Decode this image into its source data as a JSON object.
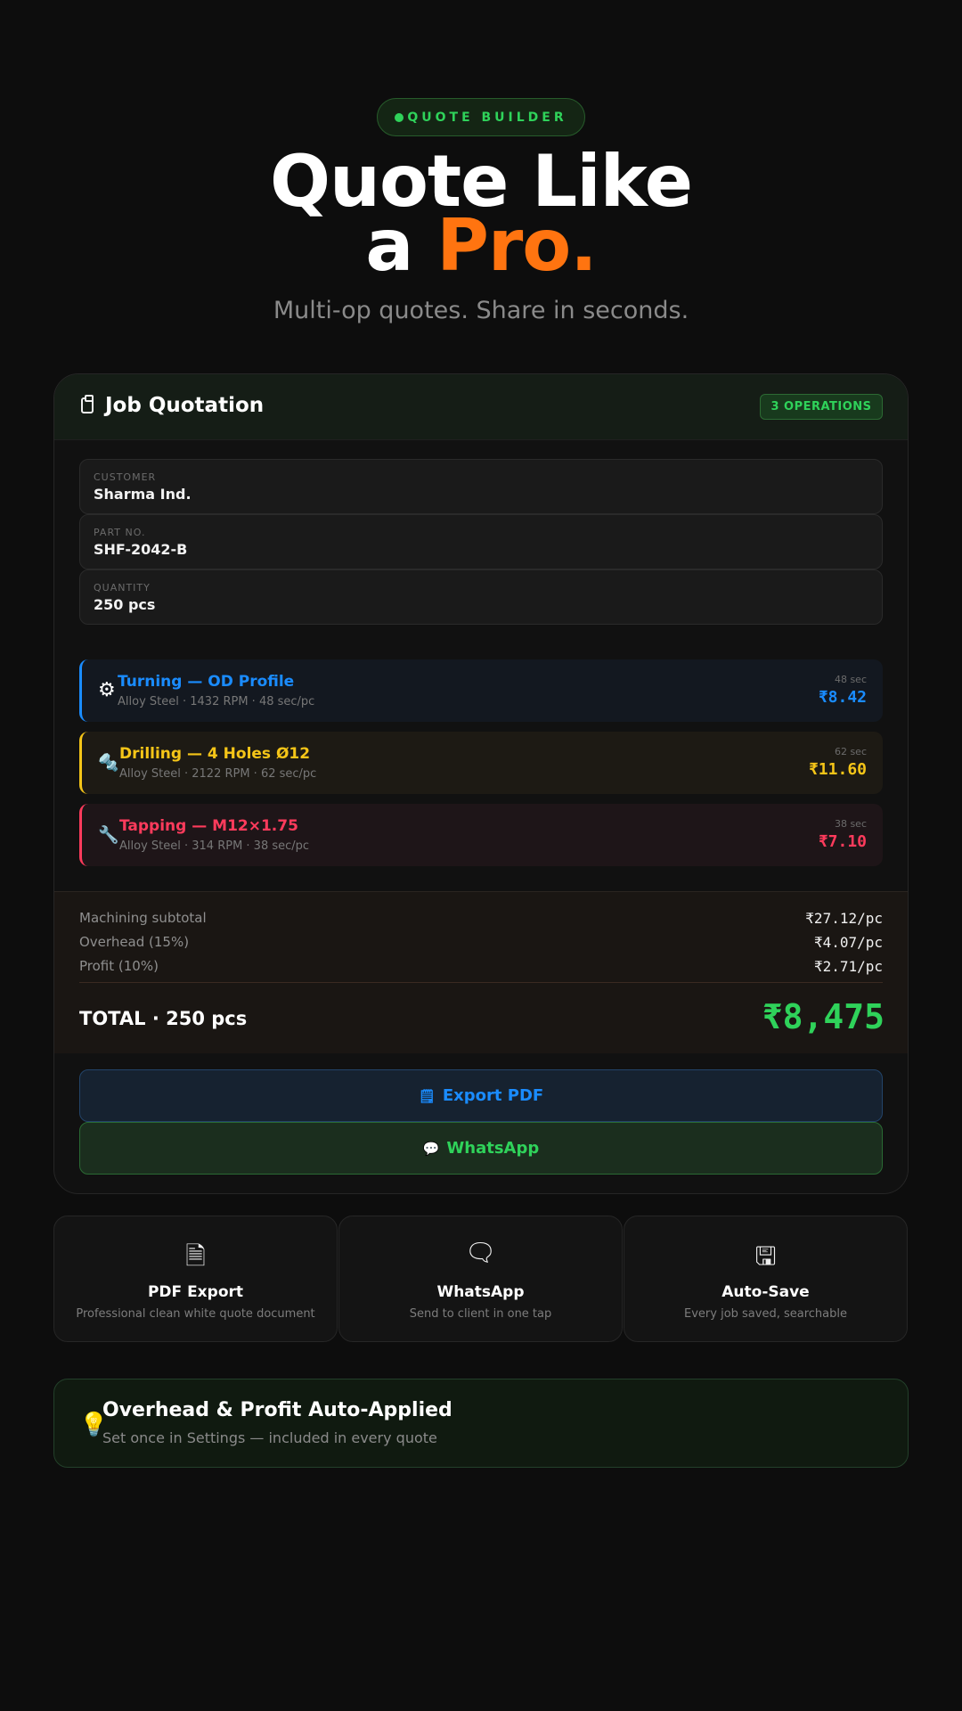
{
  "header": {
    "pill_label": "QUOTE BUILDER",
    "title_line1": "Quote Like",
    "title_line2_prefix": "a ",
    "title_line2_accent": "Pro.",
    "subtitle": "Multi-op quotes. Share in seconds."
  },
  "quote_card": {
    "title": "Job Quotation",
    "ops_badge": "3 OPERATIONS",
    "fields": [
      {
        "label": "CUSTOMER",
        "value": "Sharma Ind."
      },
      {
        "label": "PART NO.",
        "value": "SHF-2042-B"
      },
      {
        "label": "QUANTITY",
        "value": "250 pcs"
      }
    ],
    "operations": [
      {
        "icon": "gear-icon",
        "glyph": "⚙",
        "name": "Turning — OD Profile",
        "meta": "Alloy Steel · 1432 RPM · 48 sec/pc",
        "time": "48 sec",
        "price": "₹8.42",
        "color": "#1a8cff"
      },
      {
        "icon": "drill-icon",
        "glyph": "🔩",
        "name": "Drilling — 4 Holes Ø12",
        "meta": "Alloy Steel · 2122 RPM · 62 sec/pc",
        "time": "62 sec",
        "price": "₹11.60",
        "color": "#f5c518"
      },
      {
        "icon": "tap-icon",
        "glyph": "🔧",
        "name": "Tapping — M12×1.75",
        "meta": "Alloy Steel · 314 RPM · 38 sec/pc",
        "time": "38 sec",
        "price": "₹7.10",
        "color": "#ff3b5c"
      }
    ],
    "summary": {
      "rows": [
        {
          "label": "Machining subtotal",
          "value": "₹27.12/pc"
        },
        {
          "label": "Overhead (15%)",
          "value": "₹4.07/pc"
        },
        {
          "label": "Profit (10%)",
          "value": "₹2.71/pc"
        }
      ],
      "total_label": "TOTAL · 250 pcs",
      "total_value": "₹8,475"
    },
    "buttons": {
      "export_pdf": "Export PDF",
      "whatsapp": "WhatsApp"
    }
  },
  "features": [
    {
      "icon": "document-icon",
      "title": "PDF Export",
      "desc": "Professional clean white quote document"
    },
    {
      "icon": "message-icon",
      "title": "WhatsApp",
      "desc": "Send to client in one tap"
    },
    {
      "icon": "save-icon",
      "title": "Auto-Save",
      "desc": "Every job saved, searchable"
    }
  ],
  "banner": {
    "icon": "lightbulb-icon",
    "title": "Overhead & Profit Auto-Applied",
    "subtitle": "Set once in Settings — included in every quote"
  }
}
